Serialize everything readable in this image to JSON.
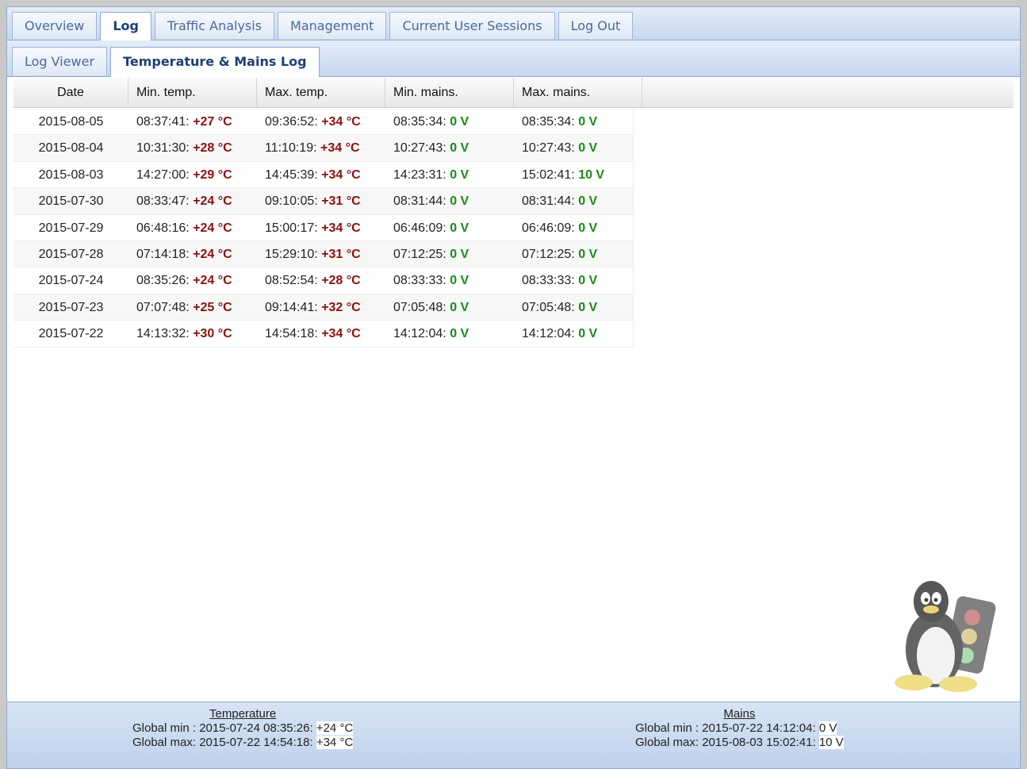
{
  "tabs_main": [
    "Overview",
    "Log",
    "Traffic Analysis",
    "Management",
    "Current User Sessions",
    "Log Out"
  ],
  "tabs_sub": [
    "Log Viewer",
    "Temperature & Mains Log"
  ],
  "columns": [
    "Date",
    "Min. temp.",
    "Max. temp.",
    "Min. mains.",
    "Max. mains."
  ],
  "rows": [
    {
      "date": "2015-08-05",
      "min_t_time": "08:37:41:",
      "min_t": "+27 °C",
      "max_t_time": "09:36:52:",
      "max_t": "+34 °C",
      "min_m_time": "08:35:34:",
      "min_m": "0 V",
      "max_m_time": "08:35:34:",
      "max_m": "0 V"
    },
    {
      "date": "2015-08-04",
      "min_t_time": "10:31:30:",
      "min_t": "+28 °C",
      "max_t_time": "11:10:19:",
      "max_t": "+34 °C",
      "min_m_time": "10:27:43:",
      "min_m": "0 V",
      "max_m_time": "10:27:43:",
      "max_m": "0 V"
    },
    {
      "date": "2015-08-03",
      "min_t_time": "14:27:00:",
      "min_t": "+29 °C",
      "max_t_time": "14:45:39:",
      "max_t": "+34 °C",
      "min_m_time": "14:23:31:",
      "min_m": "0 V",
      "max_m_time": "15:02:41:",
      "max_m": "10 V"
    },
    {
      "date": "2015-07-30",
      "min_t_time": "08:33:47:",
      "min_t": "+24 °C",
      "max_t_time": "09:10:05:",
      "max_t": "+31 °C",
      "min_m_time": "08:31:44:",
      "min_m": "0 V",
      "max_m_time": "08:31:44:",
      "max_m": "0 V"
    },
    {
      "date": "2015-07-29",
      "min_t_time": "06:48:16:",
      "min_t": "+24 °C",
      "max_t_time": "15:00:17:",
      "max_t": "+34 °C",
      "min_m_time": "06:46:09:",
      "min_m": "0 V",
      "max_m_time": "06:46:09:",
      "max_m": "0 V"
    },
    {
      "date": "2015-07-28",
      "min_t_time": "07:14:18:",
      "min_t": "+24 °C",
      "max_t_time": "15:29:10:",
      "max_t": "+31 °C",
      "min_m_time": "07:12:25:",
      "min_m": "0 V",
      "max_m_time": "07:12:25:",
      "max_m": "0 V"
    },
    {
      "date": "2015-07-24",
      "min_t_time": "08:35:26:",
      "min_t": "+24 °C",
      "max_t_time": "08:52:54:",
      "max_t": "+28 °C",
      "min_m_time": "08:33:33:",
      "min_m": "0 V",
      "max_m_time": "08:33:33:",
      "max_m": "0 V"
    },
    {
      "date": "2015-07-23",
      "min_t_time": "07:07:48:",
      "min_t": "+25 °C",
      "max_t_time": "09:14:41:",
      "max_t": "+32 °C",
      "min_m_time": "07:05:48:",
      "min_m": "0 V",
      "max_m_time": "07:05:48:",
      "max_m": "0 V"
    },
    {
      "date": "2015-07-22",
      "min_t_time": "14:13:32:",
      "min_t": "+30 °C",
      "max_t_time": "14:54:18:",
      "max_t": "+34 °C",
      "min_m_time": "14:12:04:",
      "min_m": "0 V",
      "max_m_time": "14:12:04:",
      "max_m": "0 V"
    }
  ],
  "footer": {
    "temperature": {
      "heading": "Temperature",
      "min_label": "Global min : 2015-07-24 08:35:26:",
      "min_value": "+24 °C",
      "max_label": "Global max: 2015-07-22 14:54:18:",
      "max_value": "+34 °C"
    },
    "mains": {
      "heading": "Mains",
      "min_label": "Global min : 2015-07-22 14:12:04:",
      "min_value": "0 V",
      "max_label": "Global max: 2015-08-03 15:02:41:",
      "max_value": "10 V"
    }
  },
  "colors": {
    "temp_value": "#8b1010",
    "volt_value": "#1a8a1a",
    "accent": "#1e3f78"
  }
}
